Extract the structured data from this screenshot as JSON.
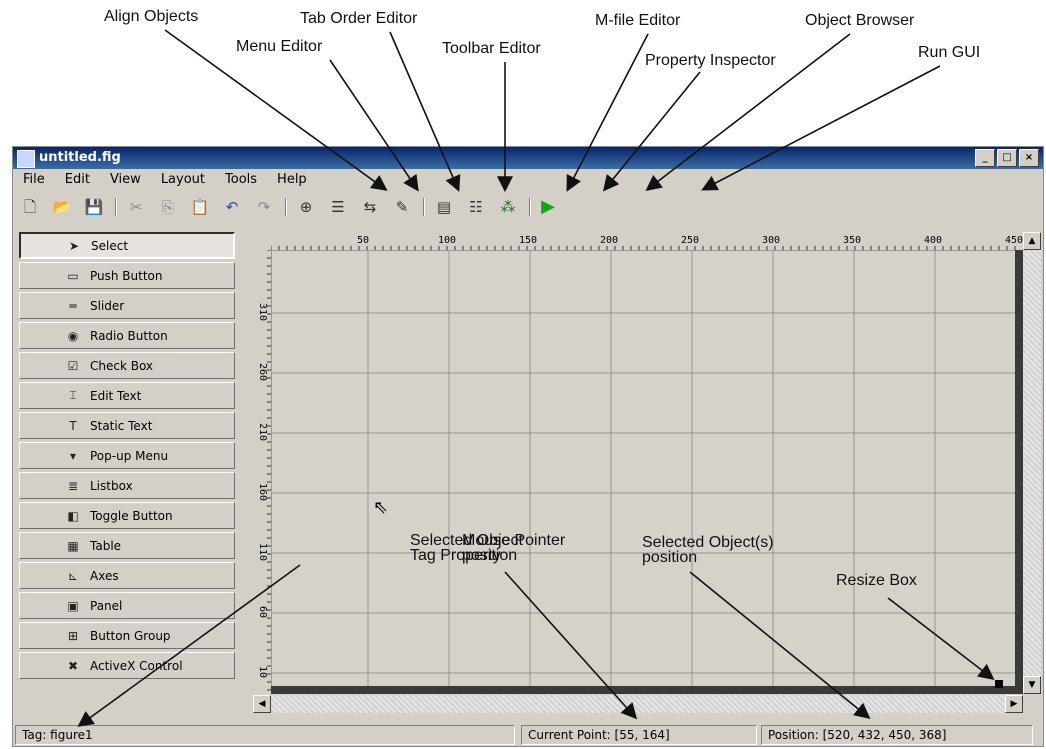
{
  "callouts": {
    "align_objects": "Align Objects",
    "menu_editor": "Menu Editor",
    "tab_order_editor": "Tab Order Editor",
    "toolbar_editor": "Toolbar Editor",
    "mfile_editor": "M-file Editor",
    "property_inspector": "Property Inspector",
    "object_browser": "Object Browser",
    "run_gui": "Run GUI",
    "selected_object_tag_1": "Selected Object",
    "selected_object_tag_2": "Tag Property",
    "mouse_pointer_1": "Mouse Pointer",
    "mouse_pointer_2": "position",
    "selected_objects_pos_1": "Selected Object(s)",
    "selected_objects_pos_2": "position",
    "resize_box": "Resize Box"
  },
  "window": {
    "title": "untitled.fig",
    "buttons": [
      "_",
      "□",
      "×"
    ]
  },
  "menu": [
    "File",
    "Edit",
    "View",
    "Layout",
    "Tools",
    "Help"
  ],
  "toolbar": {
    "new": "🗋",
    "open": "📂",
    "save": "💾",
    "cut": "✂",
    "copy": "⎘",
    "paste": "📋",
    "undo": "↶",
    "redo": "↷",
    "align": "⊕",
    "menu_editor": "☰",
    "tab_order": "⇆",
    "toolbar_editor": "✎",
    "mfile": "▤",
    "inspector": "☷",
    "browser": "⁂",
    "run": "▶"
  },
  "palette": [
    {
      "label": "Select",
      "icon": "➤"
    },
    {
      "label": "Push Button",
      "icon": "▭"
    },
    {
      "label": "Slider",
      "icon": "═"
    },
    {
      "label": "Radio Button",
      "icon": "◉"
    },
    {
      "label": "Check Box",
      "icon": "☑"
    },
    {
      "label": "Edit Text",
      "icon": "⌶"
    },
    {
      "label": "Static Text",
      "icon": "T"
    },
    {
      "label": "Pop-up Menu",
      "icon": "▾"
    },
    {
      "label": "Listbox",
      "icon": "≣"
    },
    {
      "label": "Toggle Button",
      "icon": "◧"
    },
    {
      "label": "Table",
      "icon": "▦"
    },
    {
      "label": "Axes",
      "icon": "⊾"
    },
    {
      "label": "Panel",
      "icon": "▣"
    },
    {
      "label": "Button Group",
      "icon": "⊞"
    },
    {
      "label": "ActiveX Control",
      "icon": "✖"
    }
  ],
  "ruler_top": [
    "50",
    "100",
    "150",
    "200",
    "250",
    "300",
    "350",
    "400",
    "450"
  ],
  "ruler_left": [
    "310",
    "260",
    "210",
    "160",
    "110",
    "60",
    "10"
  ],
  "status": {
    "tag": "Tag: figure1",
    "current_point": "Current Point:  [55, 164]",
    "position": "Position: [520, 432, 450, 368]"
  },
  "accent_colors": {
    "titlebar": "#0a246a",
    "run": "#1aa31a"
  }
}
